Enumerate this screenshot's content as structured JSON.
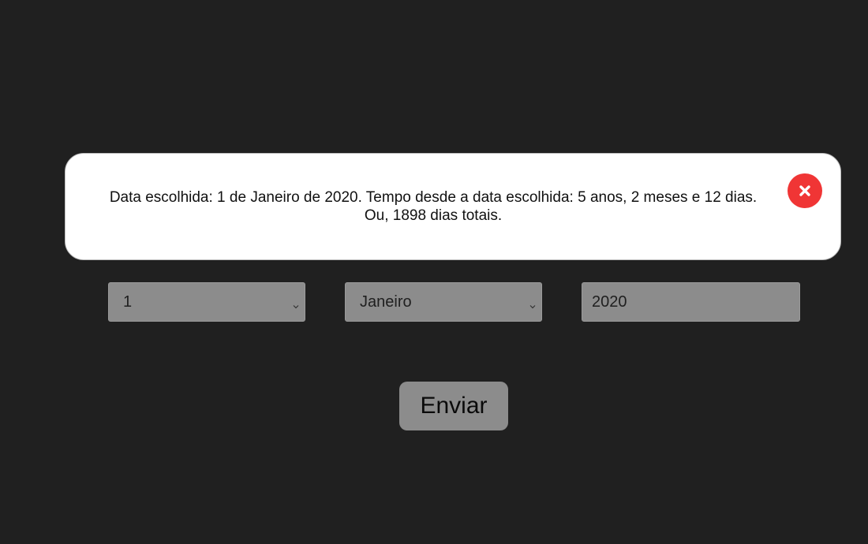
{
  "result": {
    "line1": "Data escolhida: 1 de Janeiro de 2020. Tempo desde a data escolhida: 5 anos, 2 meses e 12 dias.",
    "line2": "Ou, 1898 dias totais.",
    "close_icon": "close-x-icon"
  },
  "form": {
    "day_value": "1",
    "month_value": "Janeiro",
    "year_value": "2020",
    "chevron_icon": "chevron-down-icon",
    "submit_label": "Enviar"
  },
  "colors": {
    "background": "#202020",
    "popup": "#ffffff",
    "field": "#8c8c8c",
    "close_accent": "#f03535"
  }
}
